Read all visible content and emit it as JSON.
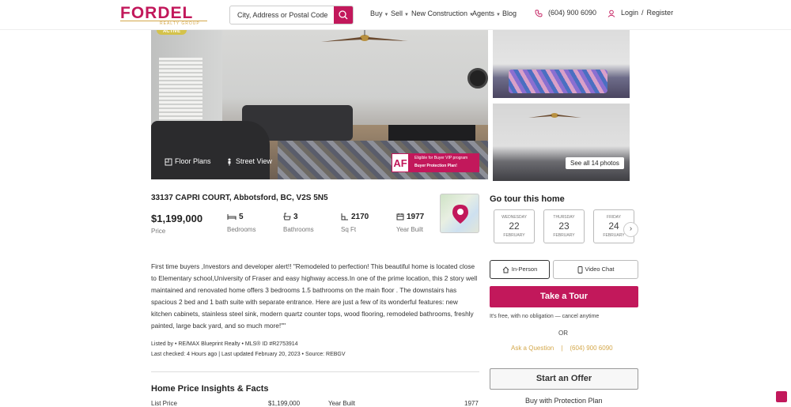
{
  "brand": {
    "name": "FORDEL",
    "tagline": "REALTY GROUP",
    "primary_color": "#c2185b",
    "accent_color": "#d4a84b"
  },
  "header": {
    "search_placeholder": "City, Address or Postal Code",
    "nav": [
      {
        "label": "Buy",
        "has_dropdown": true
      },
      {
        "label": "Sell",
        "has_dropdown": true
      },
      {
        "label": "New Construction",
        "has_dropdown": true
      },
      {
        "label": "Agents",
        "has_dropdown": true
      },
      {
        "label": "Blog",
        "has_dropdown": false
      }
    ],
    "phone": "(604) 900 6090",
    "login": "Login",
    "separator": "/",
    "register": "Register"
  },
  "gallery": {
    "status_badge": "ACTIVE",
    "floor_plans": "Floor Plans",
    "street_view": "Street View",
    "promo_logo": "AF",
    "promo_line1": "Eligible for Buyer VIP program",
    "promo_line2": "Buyer Protection Plan!",
    "see_all": "See all 14 photos"
  },
  "listing": {
    "address": "33137 CAPRI COURT, Abbotsford, BC, V2S 5N5",
    "price": "$1,199,000",
    "price_label": "Price",
    "bedrooms": "5",
    "bedrooms_label": "Bedrooms",
    "bathrooms": "3",
    "bathrooms_label": "Bathrooms",
    "sqft": "2170",
    "sqft_label": "Sq Ft",
    "year_built": "1977",
    "year_built_label": "Year Built",
    "description": "First time buyers ,Investors and developer alert!! \"Remodeled to perfection! This beautiful home is located close to Elementary school,University of Fraser and easy highway access.In one of the prime location, this 2 story well maintained and renovated home offers 3 bedrooms 1.5 bathrooms on the main floor . The downstairs has spacious 2 bed and 1 bath suite with separate entrance. Here are just a few of its wonderful features: new kitchen cabinets, stainless steel sink, modern quartz counter tops, wood flooring, remodeled bathrooms, freshly painted, large back yard, and so much more!\"\"",
    "listed_by": "Listed by • RE/MAX Blueprint Realty • MLS® ID #R2753914",
    "last_checked": "Last checked: 4 Hours ago | Last updated February 20, 2023 • Source: REBGV"
  },
  "insights": {
    "title": "Home Price Insights & Facts",
    "list_price_label": "List Price",
    "list_price": "$1,199,000",
    "year_built_label": "Year Built",
    "year_built": "1977"
  },
  "tour": {
    "title": "Go tour this home",
    "days": [
      {
        "dow": "WEDNESDAY",
        "num": "22",
        "month": "FEBRUARY"
      },
      {
        "dow": "THURSDAY",
        "num": "23",
        "month": "FEBRUARY"
      },
      {
        "dow": "FRIDAY",
        "num": "24",
        "month": "FEBRUARY"
      }
    ],
    "in_person": "In-Person",
    "video_chat": "Video Chat",
    "take_tour": "Take a Tour",
    "free_note": "It's free, with no obligation — cancel anytime",
    "or": "OR",
    "ask_question": "Ask a Question",
    "separator": "|",
    "phone": "(604) 900 6090",
    "start_offer": "Start an Offer",
    "protection": "Buy with Protection Plan"
  }
}
